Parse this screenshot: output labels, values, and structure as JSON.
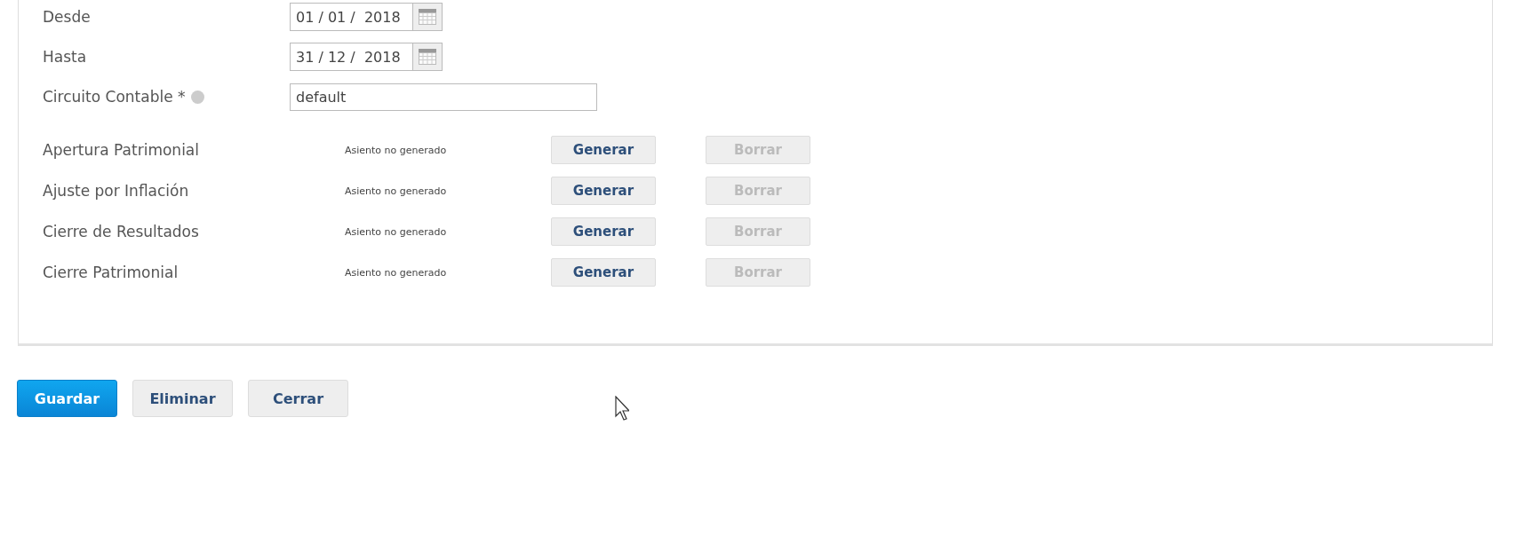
{
  "fields": [
    {
      "kind": "date",
      "label": "Desde",
      "value": "01 / 01 /  2018"
    },
    {
      "kind": "date",
      "label": "Hasta",
      "value": "31 / 12 /  2018"
    },
    {
      "kind": "text",
      "label": "Circuito Contable *",
      "help": true,
      "value": "default"
    }
  ],
  "entries": [
    {
      "name": "Apertura Patrimonial",
      "status": "Asiento no generado",
      "generate": {
        "label": "Generar",
        "disabled": false
      },
      "delete": {
        "label": "Borrar",
        "disabled": true
      }
    },
    {
      "name": "Ajuste por Inflación",
      "status": "Asiento no generado",
      "generate": {
        "label": "Generar",
        "disabled": false
      },
      "delete": {
        "label": "Borrar",
        "disabled": true
      }
    },
    {
      "name": "Cierre de Resultados",
      "status": "Asiento no generado",
      "generate": {
        "label": "Generar",
        "disabled": false
      },
      "delete": {
        "label": "Borrar",
        "disabled": true
      }
    },
    {
      "name": "Cierre Patrimonial",
      "status": "Asiento no generado",
      "generate": {
        "label": "Generar",
        "disabled": false
      },
      "delete": {
        "label": "Borrar",
        "disabled": true
      }
    }
  ],
  "actions": [
    {
      "label": "Guardar",
      "kind": "primary"
    },
    {
      "label": "Eliminar",
      "kind": "secondary"
    },
    {
      "label": "Cerrar",
      "kind": "secondary"
    }
  ]
}
